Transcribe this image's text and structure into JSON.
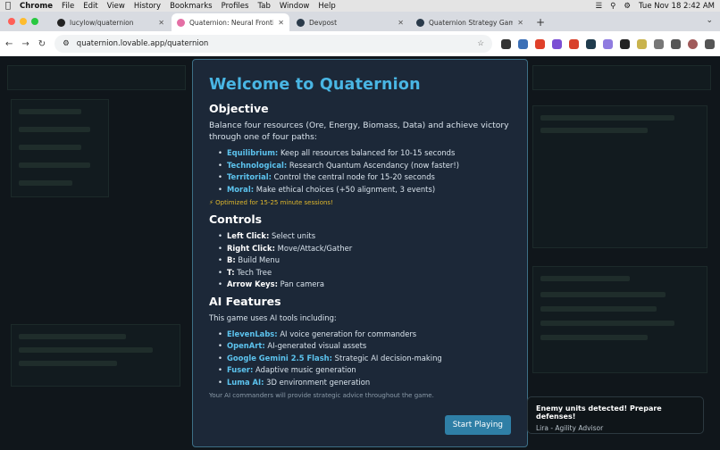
{
  "menubar": {
    "app": "Chrome",
    "items": [
      "File",
      "Edit",
      "View",
      "History",
      "Bookmarks",
      "Profiles",
      "Tab",
      "Window",
      "Help"
    ],
    "clock": "Tue Nov 18  2:42 AM"
  },
  "browser": {
    "tabs": [
      {
        "title": "lucylow/quaternion",
        "favicon_color": "#222222"
      },
      {
        "title": "Quaternion: Neural Frontier |",
        "favicon_color": "#e46fa5"
      },
      {
        "title": "Devpost",
        "favicon_color": "#2a3a4a"
      },
      {
        "title": "Quaternion Strategy Game | D",
        "favicon_color": "#2a3a4a"
      }
    ],
    "url": "quaternion.lovable.app/quaternion"
  },
  "modal": {
    "title": "Welcome to Quaternion",
    "objective_heading": "Objective",
    "objective_text": "Balance four resources (Ore, Energy, Biomass, Data) and achieve victory through one of four paths:",
    "paths": [
      {
        "name": "Equilibrium:",
        "desc": "Keep all resources balanced for 10-15 seconds"
      },
      {
        "name": "Technological:",
        "desc": "Research Quantum Ascendancy (now faster!)"
      },
      {
        "name": "Territorial:",
        "desc": "Control the central node for 15-20 seconds"
      },
      {
        "name": "Moral:",
        "desc": "Make ethical choices (+50 alignment, 3 events)"
      }
    ],
    "optimized_note": "⚡ Optimized for 15-25 minute sessions!",
    "controls_heading": "Controls",
    "controls": [
      {
        "key": "Left Click:",
        "desc": "Select units"
      },
      {
        "key": "Right Click:",
        "desc": "Move/Attack/Gather"
      },
      {
        "key": "B:",
        "desc": "Build Menu"
      },
      {
        "key": "T:",
        "desc": "Tech Tree"
      },
      {
        "key": "Arrow Keys:",
        "desc": "Pan camera"
      }
    ],
    "ai_heading": "AI Features",
    "ai_intro": "This game uses AI tools including:",
    "ai_tools": [
      {
        "name": "ElevenLabs:",
        "desc": "AI voice generation for commanders"
      },
      {
        "name": "OpenArt:",
        "desc": "AI-generated visual assets"
      },
      {
        "name": "Google Gemini 2.5 Flash:",
        "desc": "Strategic AI decision-making"
      },
      {
        "name": "Fuser:",
        "desc": "Adaptive music generation"
      },
      {
        "name": "Luma AI:",
        "desc": "3D environment generation"
      }
    ],
    "ai_footer": "Your AI commanders will provide strategic advice throughout the game.",
    "start_button": "Start Playing"
  },
  "toast": {
    "message": "Enemy units detected! Prepare defenses!",
    "sender": "Lira - Agility Advisor"
  }
}
